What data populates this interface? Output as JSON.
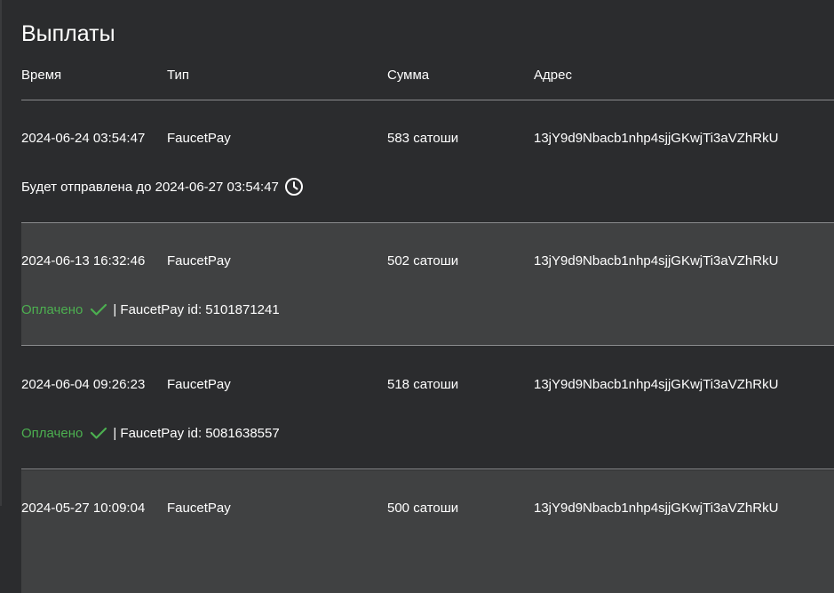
{
  "page": {
    "title": "Выплаты"
  },
  "table": {
    "headers": {
      "time": "Время",
      "type": "Тип",
      "amount": "Сумма",
      "address": "Адрес"
    },
    "rows": [
      {
        "time": "2024-06-24 03:54:47",
        "type": "FaucetPay",
        "amount": "583 сатоши",
        "address": "13jY9d9Nbacb1nhp4sjjGKwjTi3aVZhRkU",
        "status_text": "Будет отправлена до 2024-06-27 03:54:47",
        "status_icon": "clock-icon"
      },
      {
        "time": "2024-06-13 16:32:46",
        "type": "FaucetPay",
        "amount": "502 сатоши",
        "address": "13jY9d9Nbacb1nhp4sjjGKwjTi3aVZhRkU",
        "status_text": "Оплачено",
        "status_icon": "check-icon",
        "payment_id": "| FaucetPay id: 5101871241"
      },
      {
        "time": "2024-06-04 09:26:23",
        "type": "FaucetPay",
        "amount": "518 сатоши",
        "address": "13jY9d9Nbacb1nhp4sjjGKwjTi3aVZhRkU",
        "status_text": "Оплачено",
        "status_icon": "check-icon",
        "payment_id": "| FaucetPay id: 5081638557"
      },
      {
        "time": "2024-05-27 10:09:04",
        "type": "FaucetPay",
        "amount": "500 сатоши",
        "address": "13jY9d9Nbacb1nhp4sjjGKwjTi3aVZhRkU"
      }
    ]
  },
  "colors": {
    "background": "#2b2c2e",
    "alt_row": "#404142",
    "paid": "#4caf50",
    "divider": "#8a8b8d"
  }
}
